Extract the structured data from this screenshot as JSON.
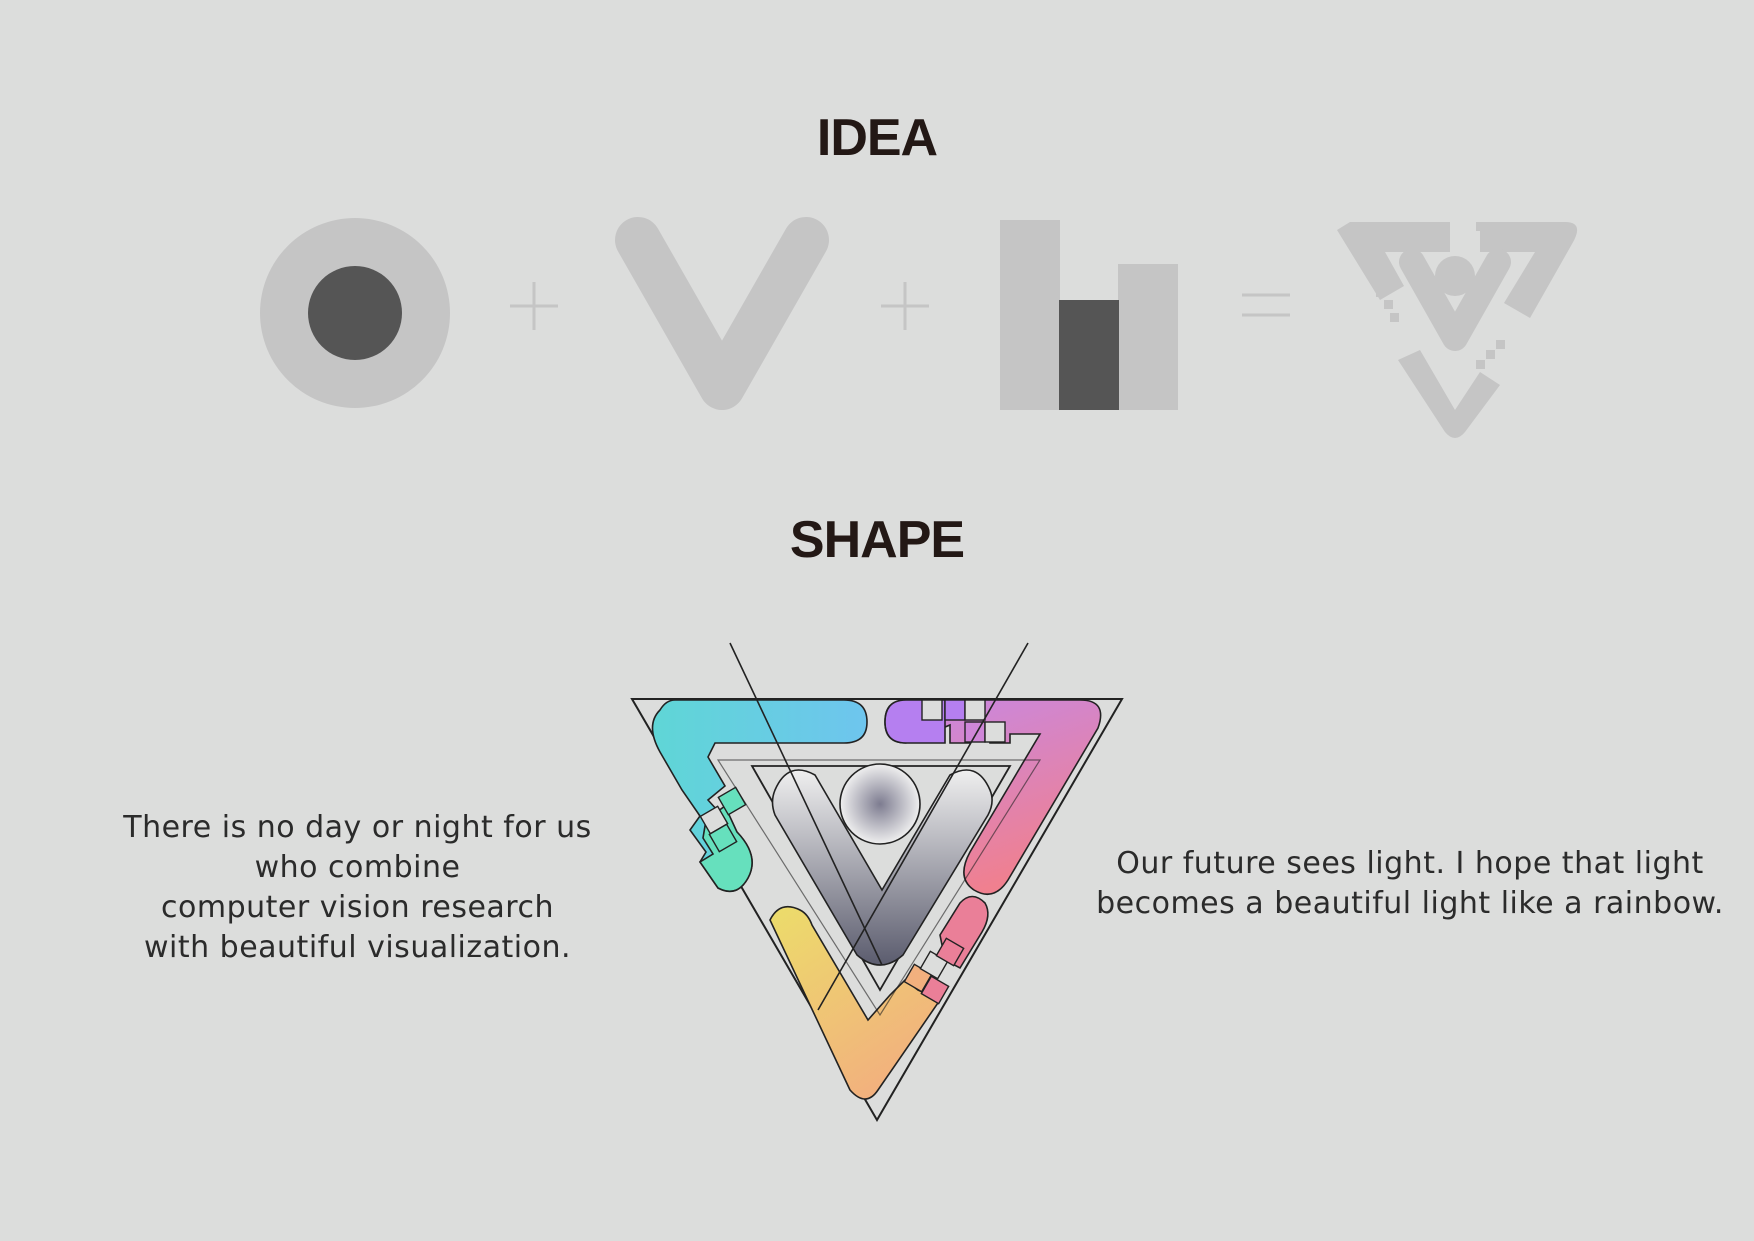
{
  "idea": {
    "title": "IDEA",
    "operators": [
      "+",
      "+",
      "="
    ],
    "elements": [
      "eye-circle-icon",
      "v-letter-icon",
      "bar-chart-icon",
      "logo-grey-icon"
    ]
  },
  "shape": {
    "title": "SHAPE",
    "left_text": [
      "There is no day or night for us",
      "who combine",
      "computer vision research",
      "with beautiful visualization."
    ],
    "right_text": [
      "Our future sees light. I hope that light",
      "becomes a beautiful light like a rainbow."
    ]
  },
  "colors": {
    "background": "#dcdddc",
    "grey_light": "#c5c5c5",
    "grey_dark": "#555555",
    "heading": "#231815",
    "cyan": "#5fd6d6",
    "blue": "#6ec5ee",
    "purple": "#b57ff0",
    "pink": "#ea7f98",
    "mint": "#66e0bd",
    "yellow": "#ecdd6a",
    "orange": "#f2b07e"
  }
}
